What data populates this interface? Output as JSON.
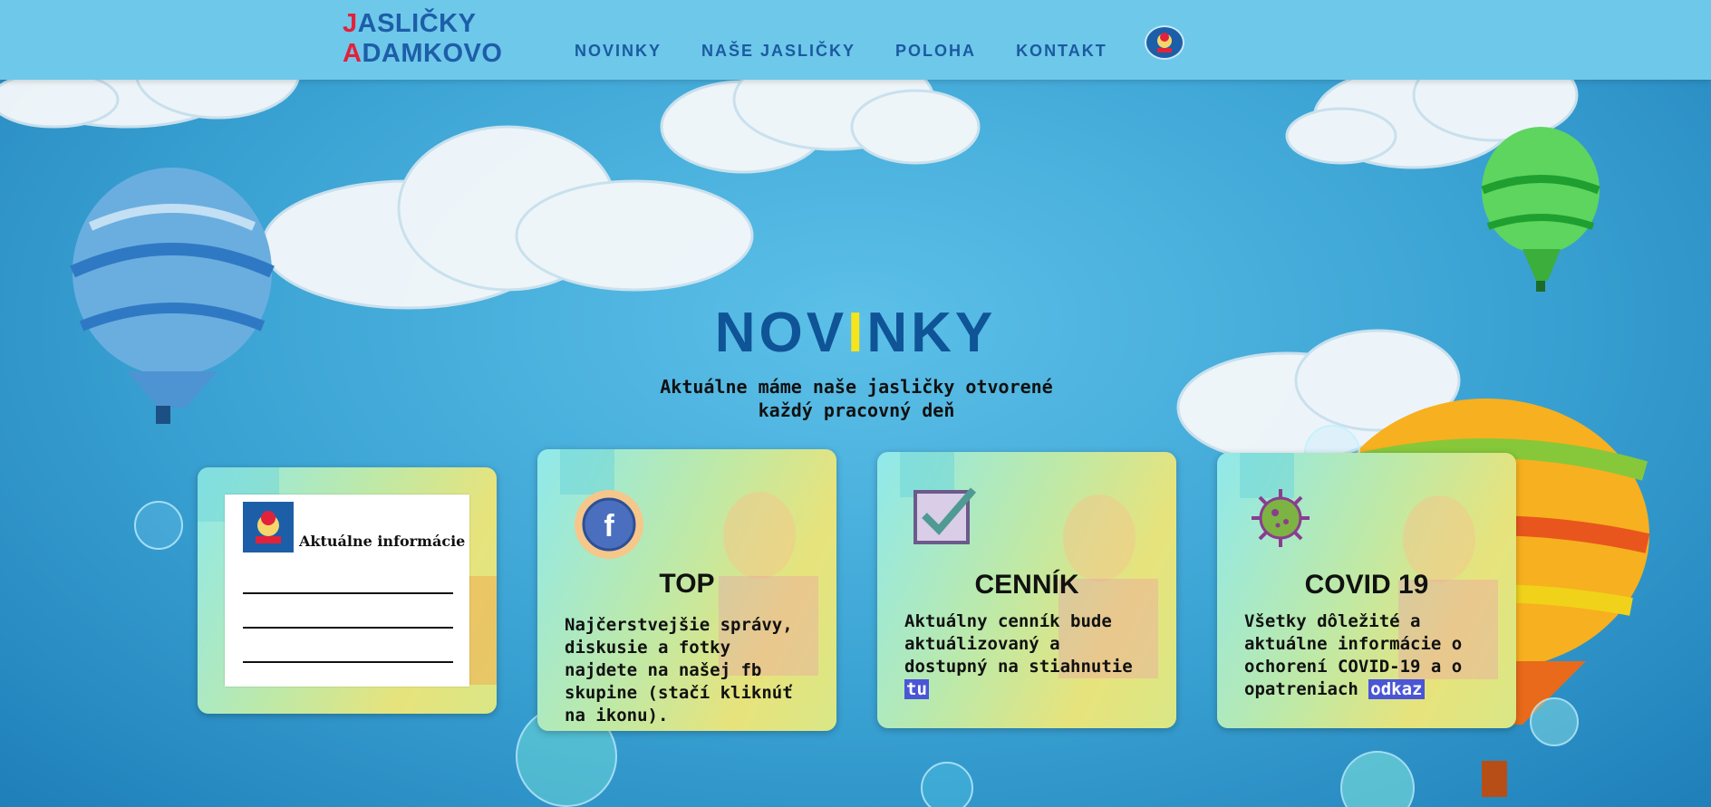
{
  "header": {
    "logo_line1_first": "J",
    "logo_line1_rest": "ASLIČKY",
    "logo_line2_first": "A",
    "logo_line2_rest": "DAMKOVO",
    "nav": [
      "NOVINKY",
      "NAŠE JASLIČKY",
      "POLOHA",
      "KONTAKT"
    ]
  },
  "hero": {
    "title_a": "NOV",
    "title_b": "I",
    "title_c": "NKY",
    "subtitle": "Aktuálne máme naše jasličky otvorené každý pracovný deň"
  },
  "cards": {
    "info": {
      "title": "Aktuálne informácie"
    },
    "top": {
      "title": "TOP",
      "text": "Najčerstvejšie správy, diskusie a fotky najdete na našej fb skupine (stačí kliknúť na ikonu).",
      "icon": "facebook-icon"
    },
    "cennik": {
      "title": "CENNÍK",
      "text": "Aktuálny cenník bude aktuálizovaný a dostupný na stiahnutie",
      "link": "tu",
      "icon": "checkbox-icon"
    },
    "covid": {
      "title": "COVID 19",
      "text": "Všetky dôležité a aktuálne informácie o ochorení COVID-19 a o opatreniach",
      "link": "odkaz",
      "icon": "virus-icon"
    }
  },
  "colors": {
    "header_bg": "#6ec8ea",
    "brand_blue": "#1b5aa0",
    "brand_red": "#e2223b",
    "title_accent": "#f6e41c",
    "link_bg": "#4a56d6"
  }
}
